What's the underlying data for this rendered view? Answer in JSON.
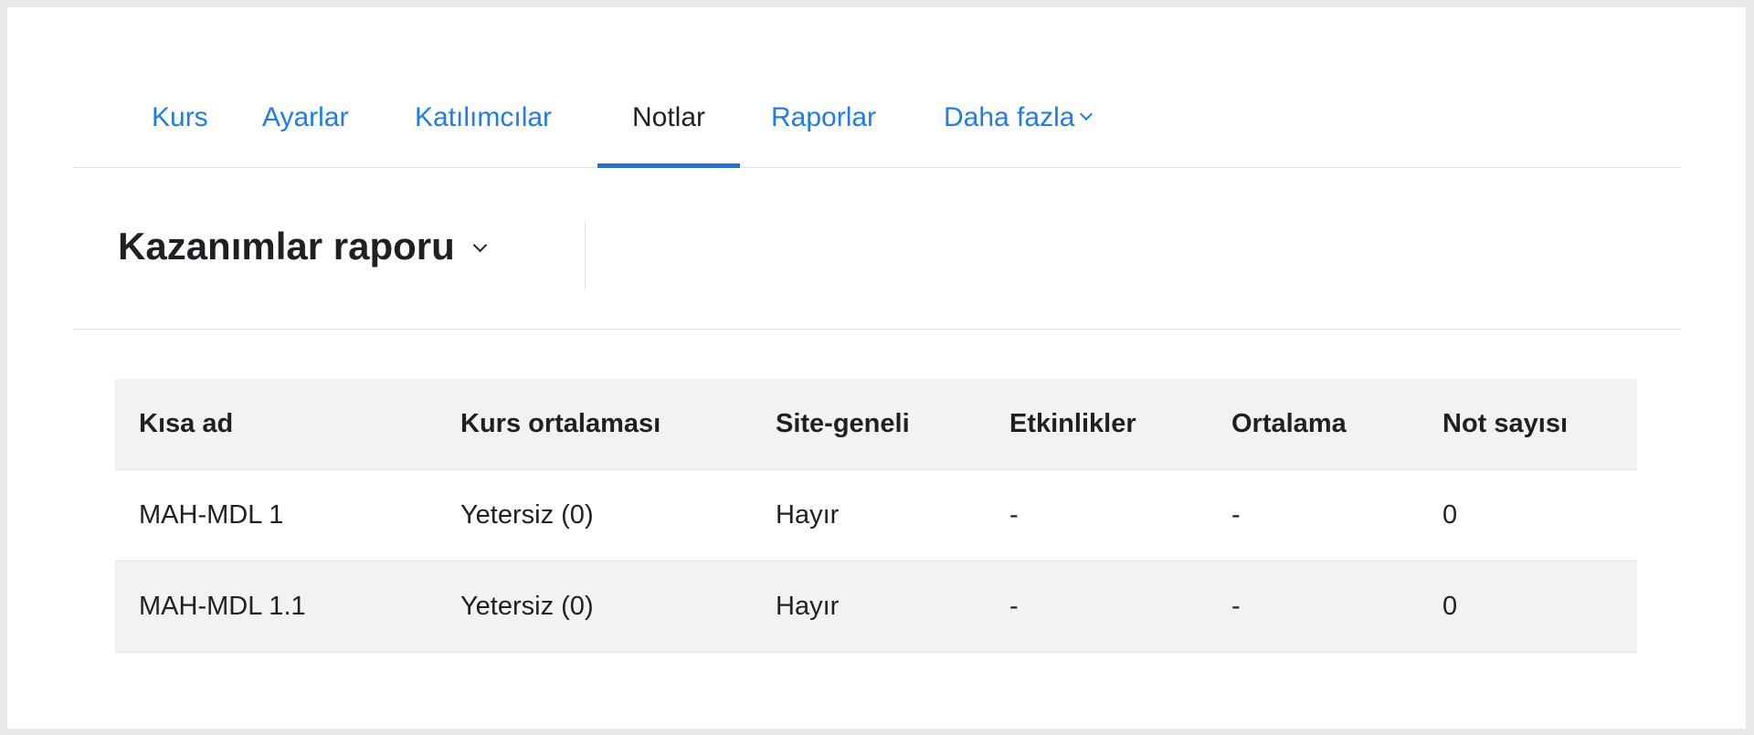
{
  "nav": {
    "items": [
      {
        "label": "Kurs",
        "active": false
      },
      {
        "label": "Ayarlar",
        "active": false
      },
      {
        "label": "Katılımcılar",
        "active": false
      },
      {
        "label": "Notlar",
        "active": true
      },
      {
        "label": "Raporlar",
        "active": false
      },
      {
        "label": "Daha fazla",
        "active": false,
        "icon": "chevron-down-icon"
      }
    ]
  },
  "report": {
    "title": "Kazanımlar raporu",
    "icon": "chevron-down-icon"
  },
  "table": {
    "headers": [
      "Kısa ad",
      "Kurs ortalaması",
      "Site-geneli",
      "Etkinlikler",
      "Ortalama",
      "Not sayısı"
    ],
    "rows": [
      [
        "MAH-MDL 1",
        "Yetersiz (0)",
        "Hayır",
        "-",
        "-",
        "0"
      ],
      [
        "MAH-MDL 1.1",
        "Yetersiz (0)",
        "Hayır",
        "-",
        "-",
        "0"
      ]
    ]
  },
  "colors": {
    "link": "#1f7ce8",
    "active_text": "#1d2125",
    "active_underline": "#1a73d9",
    "header_bg": "#f2f2f2",
    "border": "#dee2e6"
  }
}
